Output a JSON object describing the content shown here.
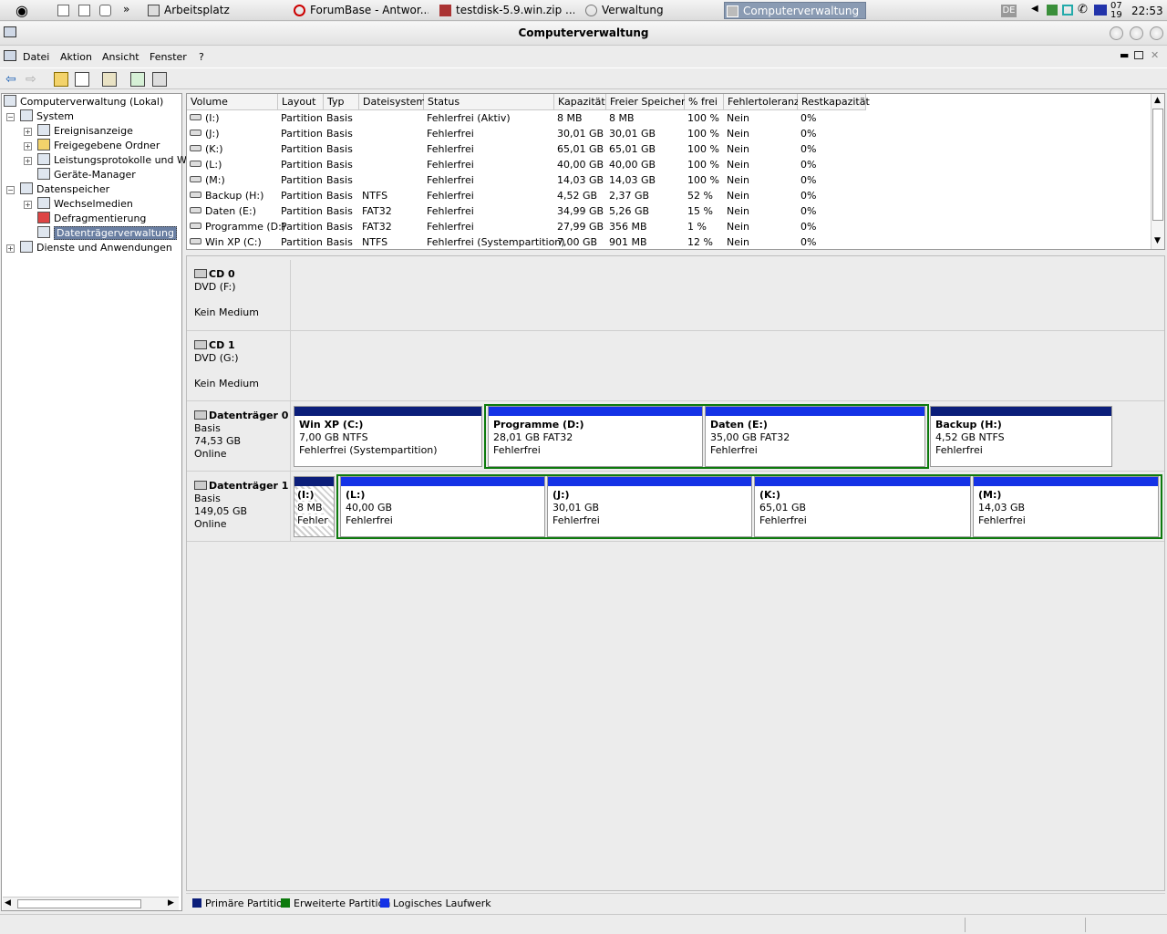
{
  "taskbar": {
    "items": [
      {
        "label": "Arbeitsplatz",
        "active": false
      },
      {
        "label": "ForumBase - Antwor...",
        "active": false
      },
      {
        "label": "testdisk-5.9.win.zip ...",
        "active": false
      },
      {
        "label": "Verwaltung",
        "active": false
      },
      {
        "label": "Computerverwaltung",
        "active": true
      }
    ],
    "lang": "DE",
    "date_top": "07",
    "date_bottom": "19",
    "clock": "22:53"
  },
  "window": {
    "title": "Computerverwaltung"
  },
  "menu": {
    "datei": "Datei",
    "aktion": "Aktion",
    "ansicht": "Ansicht",
    "fenster": "Fenster",
    "help": "?"
  },
  "tree": {
    "root": "Computerverwaltung (Lokal)",
    "system": "System",
    "ereignis": "Ereignisanzeige",
    "freigegeben": "Freigegebene Ordner",
    "leistung": "Leistungsprotokolle und War",
    "geraete": "Geräte-Manager",
    "datenspeicher": "Datenspeicher",
    "wechselmedien": "Wechselmedien",
    "defrag": "Defragmentierung",
    "dtverwaltung": "Datenträgerverwaltung",
    "dienste": "Dienste und Anwendungen"
  },
  "list": {
    "headers": [
      "Volume",
      "Layout",
      "Typ",
      "Dateisystem",
      "Status",
      "Kapazität",
      "Freier Speicher",
      "% frei",
      "Fehlertoleranz",
      "Restkapazität"
    ],
    "rows": [
      [
        "(I:)",
        "Partition",
        "Basis",
        "",
        "Fehlerfrei (Aktiv)",
        "8 MB",
        "8 MB",
        "100 %",
        "Nein",
        "0%"
      ],
      [
        "(J:)",
        "Partition",
        "Basis",
        "",
        "Fehlerfrei",
        "30,01 GB",
        "30,01 GB",
        "100 %",
        "Nein",
        "0%"
      ],
      [
        "(K:)",
        "Partition",
        "Basis",
        "",
        "Fehlerfrei",
        "65,01 GB",
        "65,01 GB",
        "100 %",
        "Nein",
        "0%"
      ],
      [
        "(L:)",
        "Partition",
        "Basis",
        "",
        "Fehlerfrei",
        "40,00 GB",
        "40,00 GB",
        "100 %",
        "Nein",
        "0%"
      ],
      [
        "(M:)",
        "Partition",
        "Basis",
        "",
        "Fehlerfrei",
        "14,03 GB",
        "14,03 GB",
        "100 %",
        "Nein",
        "0%"
      ],
      [
        "Backup (H:)",
        "Partition",
        "Basis",
        "NTFS",
        "Fehlerfrei",
        "4,52 GB",
        "2,37 GB",
        "52 %",
        "Nein",
        "0%"
      ],
      [
        "Daten (E:)",
        "Partition",
        "Basis",
        "FAT32",
        "Fehlerfrei",
        "34,99 GB",
        "5,26 GB",
        "15 %",
        "Nein",
        "0%"
      ],
      [
        "Programme (D:)",
        "Partition",
        "Basis",
        "FAT32",
        "Fehlerfrei",
        "27,99 GB",
        "356 MB",
        "1 %",
        "Nein",
        "0%"
      ],
      [
        "Win XP (C:)",
        "Partition",
        "Basis",
        "NTFS",
        "Fehlerfrei (Systempartition)",
        "7,00 GB",
        "901 MB",
        "12 %",
        "Nein",
        "0%"
      ]
    ]
  },
  "disks": {
    "cd0": {
      "name": "CD 0",
      "type": "DVD (F:)",
      "status": "Kein Medium"
    },
    "cd1": {
      "name": "CD 1",
      "type": "DVD (G:)",
      "status": "Kein Medium"
    },
    "d0": {
      "name": "Datenträger 0",
      "kind": "Basis",
      "size": "74,53 GB",
      "state": "Online",
      "parts": [
        {
          "name": "Win XP  (C:)",
          "size": "7,00 GB NTFS",
          "status": "Fehlerfrei (Systempartition)"
        },
        {
          "name": "Programme  (D:)",
          "size": "28,01 GB FAT32",
          "status": "Fehlerfrei"
        },
        {
          "name": "Daten  (E:)",
          "size": "35,00 GB FAT32",
          "status": "Fehlerfrei"
        },
        {
          "name": "Backup  (H:)",
          "size": "4,52 GB NTFS",
          "status": "Fehlerfrei"
        }
      ]
    },
    "d1": {
      "name": "Datenträger 1",
      "kind": "Basis",
      "size": "149,05 GB",
      "state": "Online",
      "parts": [
        {
          "name": "(I:)",
          "size": "8 MB",
          "status": "Fehler"
        },
        {
          "name": "(L:)",
          "size": "40,00 GB",
          "status": "Fehlerfrei"
        },
        {
          "name": "(J:)",
          "size": "30,01 GB",
          "status": "Fehlerfrei"
        },
        {
          "name": "(K:)",
          "size": "65,01 GB",
          "status": "Fehlerfrei"
        },
        {
          "name": "(M:)",
          "size": "14,03 GB",
          "status": "Fehlerfrei"
        }
      ]
    }
  },
  "legend": {
    "primary": "Primäre Partition",
    "extended": "Erweiterte Partition",
    "logical": "Logisches Laufwerk"
  },
  "colors": {
    "primary": "#0b1e7a",
    "extended": "#0d7a0d",
    "logical": "#1432e6"
  }
}
